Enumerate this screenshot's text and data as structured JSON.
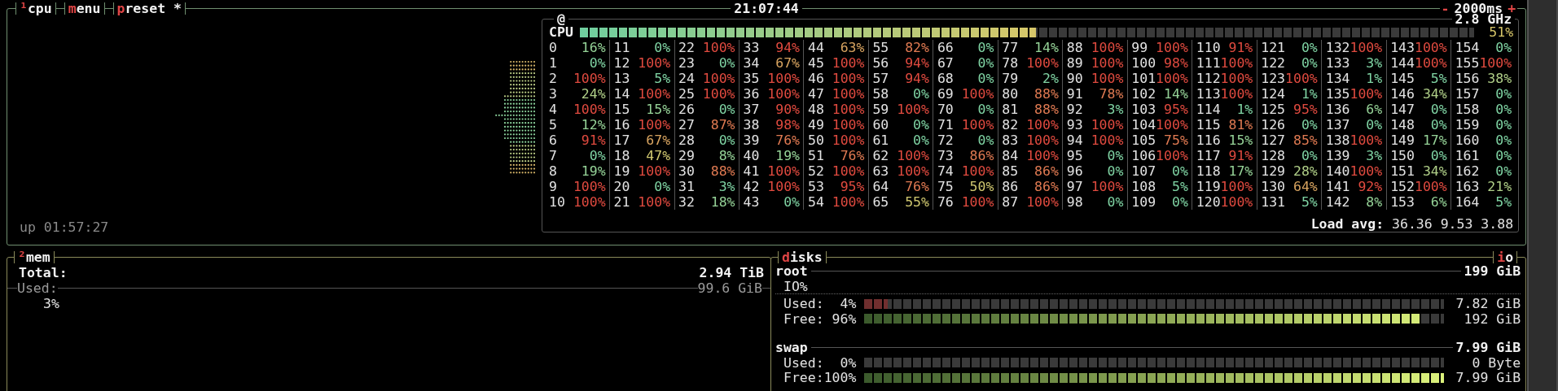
{
  "top_bar": {
    "tabs": [
      {
        "hotkey": "¹",
        "label": "cpu"
      },
      {
        "hotkey": "m",
        "label": "enu"
      },
      {
        "hotkey": "p",
        "label": "reset *"
      }
    ],
    "clock": "21:07:44",
    "interval": {
      "decrease": "-",
      "value": "2000ms",
      "increase": "+"
    }
  },
  "cpu": {
    "graph_title": "@",
    "frequency": "2.8 GHz",
    "total": {
      "label": "CPU",
      "level": 0.51,
      "reading": "51%"
    },
    "uptime": "up 01:57:27",
    "load_avg": {
      "label": "Load avg:",
      "values": "36.36 9.53 3.88"
    },
    "cores": [
      {
        "id": "0",
        "color": "#95d297",
        "reading": "16%"
      },
      {
        "id": "1",
        "color": "#7fd3a3",
        "reading": "0%"
      },
      {
        "id": "2",
        "color": "#e04a3f",
        "reading": "100%"
      },
      {
        "id": "3",
        "color": "#b0cf88",
        "reading": "24%"
      },
      {
        "id": "4",
        "color": "#e04a3f",
        "reading": "100%"
      },
      {
        "id": "5",
        "color": "#95d297",
        "reading": "12%"
      },
      {
        "id": "6",
        "color": "#e04a3f",
        "reading": "91%"
      },
      {
        "id": "7",
        "color": "#7fd3a3",
        "reading": "0%"
      },
      {
        "id": "8",
        "color": "#95d297",
        "reading": "19%"
      },
      {
        "id": "9",
        "color": "#e04a3f",
        "reading": "100%"
      },
      {
        "id": "10",
        "color": "#e04a3f",
        "reading": "100%"
      },
      {
        "id": "11",
        "color": "#7fd3a3",
        "reading": "0%"
      },
      {
        "id": "12",
        "color": "#e04a3f",
        "reading": "100%"
      },
      {
        "id": "13",
        "color": "#7fd3a3",
        "reading": "5%"
      },
      {
        "id": "14",
        "color": "#e04a3f",
        "reading": "100%"
      },
      {
        "id": "15",
        "color": "#95d297",
        "reading": "15%"
      },
      {
        "id": "16",
        "color": "#e04a3f",
        "reading": "100%"
      },
      {
        "id": "17",
        "color": "#d8a460",
        "reading": "67%"
      },
      {
        "id": "18",
        "color": "#d0c870",
        "reading": "47%"
      },
      {
        "id": "19",
        "color": "#e04a3f",
        "reading": "100%"
      },
      {
        "id": "20",
        "color": "#7fd3a3",
        "reading": "0%"
      },
      {
        "id": "21",
        "color": "#e04a3f",
        "reading": "100%"
      },
      {
        "id": "22",
        "color": "#e04a3f",
        "reading": "100%"
      },
      {
        "id": "23",
        "color": "#7fd3a3",
        "reading": "0%"
      },
      {
        "id": "24",
        "color": "#e04a3f",
        "reading": "100%"
      },
      {
        "id": "25",
        "color": "#e04a3f",
        "reading": "100%"
      },
      {
        "id": "26",
        "color": "#7fd3a3",
        "reading": "0%"
      },
      {
        "id": "27",
        "color": "#e07a52",
        "reading": "87%"
      },
      {
        "id": "28",
        "color": "#7fd3a3",
        "reading": "0%"
      },
      {
        "id": "29",
        "color": "#95d297",
        "reading": "8%"
      },
      {
        "id": "30",
        "color": "#e07a52",
        "reading": "88%"
      },
      {
        "id": "31",
        "color": "#7fd3a3",
        "reading": "3%"
      },
      {
        "id": "32",
        "color": "#95d297",
        "reading": "18%"
      },
      {
        "id": "33",
        "color": "#e04a3f",
        "reading": "94%"
      },
      {
        "id": "34",
        "color": "#d8a460",
        "reading": "67%"
      },
      {
        "id": "35",
        "color": "#e04a3f",
        "reading": "100%"
      },
      {
        "id": "36",
        "color": "#e04a3f",
        "reading": "100%"
      },
      {
        "id": "37",
        "color": "#e04a3f",
        "reading": "90%"
      },
      {
        "id": "38",
        "color": "#e04a3f",
        "reading": "98%"
      },
      {
        "id": "39",
        "color": "#e07a52",
        "reading": "76%"
      },
      {
        "id": "40",
        "color": "#95d297",
        "reading": "19%"
      },
      {
        "id": "41",
        "color": "#e04a3f",
        "reading": "100%"
      },
      {
        "id": "42",
        "color": "#e04a3f",
        "reading": "100%"
      },
      {
        "id": "43",
        "color": "#7fd3a3",
        "reading": "0%"
      },
      {
        "id": "44",
        "color": "#d8a460",
        "reading": "63%"
      },
      {
        "id": "45",
        "color": "#e04a3f",
        "reading": "100%"
      },
      {
        "id": "46",
        "color": "#e04a3f",
        "reading": "100%"
      },
      {
        "id": "47",
        "color": "#e04a3f",
        "reading": "100%"
      },
      {
        "id": "48",
        "color": "#e04a3f",
        "reading": "100%"
      },
      {
        "id": "49",
        "color": "#e04a3f",
        "reading": "100%"
      },
      {
        "id": "50",
        "color": "#e04a3f",
        "reading": "100%"
      },
      {
        "id": "51",
        "color": "#e07a52",
        "reading": "76%"
      },
      {
        "id": "52",
        "color": "#e04a3f",
        "reading": "100%"
      },
      {
        "id": "53",
        "color": "#e04a3f",
        "reading": "95%"
      },
      {
        "id": "54",
        "color": "#e04a3f",
        "reading": "100%"
      },
      {
        "id": "55",
        "color": "#e07a52",
        "reading": "82%"
      },
      {
        "id": "56",
        "color": "#e04a3f",
        "reading": "94%"
      },
      {
        "id": "57",
        "color": "#e04a3f",
        "reading": "94%"
      },
      {
        "id": "58",
        "color": "#7fd3a3",
        "reading": "0%"
      },
      {
        "id": "59",
        "color": "#e04a3f",
        "reading": "100%"
      },
      {
        "id": "60",
        "color": "#7fd3a3",
        "reading": "0%"
      },
      {
        "id": "61",
        "color": "#7fd3a3",
        "reading": "0%"
      },
      {
        "id": "62",
        "color": "#e04a3f",
        "reading": "100%"
      },
      {
        "id": "63",
        "color": "#e04a3f",
        "reading": "100%"
      },
      {
        "id": "64",
        "color": "#e07a52",
        "reading": "76%"
      },
      {
        "id": "65",
        "color": "#d0c870",
        "reading": "55%"
      },
      {
        "id": "66",
        "color": "#7fd3a3",
        "reading": "0%"
      },
      {
        "id": "67",
        "color": "#7fd3a3",
        "reading": "0%"
      },
      {
        "id": "68",
        "color": "#7fd3a3",
        "reading": "0%"
      },
      {
        "id": "69",
        "color": "#e04a3f",
        "reading": "100%"
      },
      {
        "id": "70",
        "color": "#7fd3a3",
        "reading": "0%"
      },
      {
        "id": "71",
        "color": "#e04a3f",
        "reading": "100%"
      },
      {
        "id": "72",
        "color": "#7fd3a3",
        "reading": "0%"
      },
      {
        "id": "73",
        "color": "#e07a52",
        "reading": "86%"
      },
      {
        "id": "74",
        "color": "#e04a3f",
        "reading": "100%"
      },
      {
        "id": "75",
        "color": "#d0c870",
        "reading": "50%"
      },
      {
        "id": "76",
        "color": "#e04a3f",
        "reading": "100%"
      },
      {
        "id": "77",
        "color": "#95d297",
        "reading": "14%"
      },
      {
        "id": "78",
        "color": "#e04a3f",
        "reading": "100%"
      },
      {
        "id": "79",
        "color": "#7fd3a3",
        "reading": "2%"
      },
      {
        "id": "80",
        "color": "#e07a52",
        "reading": "88%"
      },
      {
        "id": "81",
        "color": "#e07a52",
        "reading": "88%"
      },
      {
        "id": "82",
        "color": "#e04a3f",
        "reading": "100%"
      },
      {
        "id": "83",
        "color": "#e04a3f",
        "reading": "100%"
      },
      {
        "id": "84",
        "color": "#e04a3f",
        "reading": "100%"
      },
      {
        "id": "85",
        "color": "#e07a52",
        "reading": "86%"
      },
      {
        "id": "86",
        "color": "#e07a52",
        "reading": "86%"
      },
      {
        "id": "87",
        "color": "#e04a3f",
        "reading": "100%"
      },
      {
        "id": "88",
        "color": "#e04a3f",
        "reading": "100%"
      },
      {
        "id": "89",
        "color": "#e04a3f",
        "reading": "100%"
      },
      {
        "id": "90",
        "color": "#e04a3f",
        "reading": "100%"
      },
      {
        "id": "91",
        "color": "#e07a52",
        "reading": "78%"
      },
      {
        "id": "92",
        "color": "#7fd3a3",
        "reading": "3%"
      },
      {
        "id": "93",
        "color": "#e04a3f",
        "reading": "100%"
      },
      {
        "id": "94",
        "color": "#e04a3f",
        "reading": "100%"
      },
      {
        "id": "95",
        "color": "#7fd3a3",
        "reading": "0%"
      },
      {
        "id": "96",
        "color": "#7fd3a3",
        "reading": "0%"
      },
      {
        "id": "97",
        "color": "#e04a3f",
        "reading": "100%"
      },
      {
        "id": "98",
        "color": "#7fd3a3",
        "reading": "0%"
      },
      {
        "id": "99",
        "color": "#e04a3f",
        "reading": "100%"
      },
      {
        "id": "100",
        "color": "#e04a3f",
        "reading": "98%"
      },
      {
        "id": "101",
        "color": "#e04a3f",
        "reading": "100%"
      },
      {
        "id": "102",
        "color": "#95d297",
        "reading": "14%"
      },
      {
        "id": "103",
        "color": "#e04a3f",
        "reading": "95%"
      },
      {
        "id": "104",
        "color": "#e04a3f",
        "reading": "100%"
      },
      {
        "id": "105",
        "color": "#e07a52",
        "reading": "75%"
      },
      {
        "id": "106",
        "color": "#e04a3f",
        "reading": "100%"
      },
      {
        "id": "107",
        "color": "#7fd3a3",
        "reading": "0%"
      },
      {
        "id": "108",
        "color": "#7fd3a3",
        "reading": "5%"
      },
      {
        "id": "109",
        "color": "#7fd3a3",
        "reading": "0%"
      },
      {
        "id": "110",
        "color": "#e04a3f",
        "reading": "91%"
      },
      {
        "id": "111",
        "color": "#e04a3f",
        "reading": "100%"
      },
      {
        "id": "112",
        "color": "#e04a3f",
        "reading": "100%"
      },
      {
        "id": "113",
        "color": "#e04a3f",
        "reading": "100%"
      },
      {
        "id": "114",
        "color": "#7fd3a3",
        "reading": "1%"
      },
      {
        "id": "115",
        "color": "#e07a52",
        "reading": "81%"
      },
      {
        "id": "116",
        "color": "#95d297",
        "reading": "15%"
      },
      {
        "id": "117",
        "color": "#e04a3f",
        "reading": "91%"
      },
      {
        "id": "118",
        "color": "#95d297",
        "reading": "17%"
      },
      {
        "id": "119",
        "color": "#e04a3f",
        "reading": "100%"
      },
      {
        "id": "120",
        "color": "#e04a3f",
        "reading": "100%"
      },
      {
        "id": "121",
        "color": "#7fd3a3",
        "reading": "0%"
      },
      {
        "id": "122",
        "color": "#7fd3a3",
        "reading": "0%"
      },
      {
        "id": "123",
        "color": "#e04a3f",
        "reading": "100%"
      },
      {
        "id": "124",
        "color": "#7fd3a3",
        "reading": "1%"
      },
      {
        "id": "125",
        "color": "#e04a3f",
        "reading": "95%"
      },
      {
        "id": "126",
        "color": "#7fd3a3",
        "reading": "0%"
      },
      {
        "id": "127",
        "color": "#e07a52",
        "reading": "85%"
      },
      {
        "id": "128",
        "color": "#7fd3a3",
        "reading": "0%"
      },
      {
        "id": "129",
        "color": "#b0cf88",
        "reading": "28%"
      },
      {
        "id": "130",
        "color": "#d8a460",
        "reading": "64%"
      },
      {
        "id": "131",
        "color": "#7fd3a3",
        "reading": "5%"
      },
      {
        "id": "132",
        "color": "#e04a3f",
        "reading": "100%"
      },
      {
        "id": "133",
        "color": "#7fd3a3",
        "reading": "3%"
      },
      {
        "id": "134",
        "color": "#7fd3a3",
        "reading": "1%"
      },
      {
        "id": "135",
        "color": "#e04a3f",
        "reading": "100%"
      },
      {
        "id": "136",
        "color": "#95d297",
        "reading": "6%"
      },
      {
        "id": "137",
        "color": "#7fd3a3",
        "reading": "0%"
      },
      {
        "id": "138",
        "color": "#e04a3f",
        "reading": "100%"
      },
      {
        "id": "139",
        "color": "#7fd3a3",
        "reading": "3%"
      },
      {
        "id": "140",
        "color": "#e04a3f",
        "reading": "100%"
      },
      {
        "id": "141",
        "color": "#e04a3f",
        "reading": "92%"
      },
      {
        "id": "142",
        "color": "#95d297",
        "reading": "8%"
      },
      {
        "id": "143",
        "color": "#e04a3f",
        "reading": "100%"
      },
      {
        "id": "144",
        "color": "#e04a3f",
        "reading": "100%"
      },
      {
        "id": "145",
        "color": "#7fd3a3",
        "reading": "5%"
      },
      {
        "id": "146",
        "color": "#b0cf88",
        "reading": "34%"
      },
      {
        "id": "147",
        "color": "#7fd3a3",
        "reading": "0%"
      },
      {
        "id": "148",
        "color": "#7fd3a3",
        "reading": "0%"
      },
      {
        "id": "149",
        "color": "#95d297",
        "reading": "17%"
      },
      {
        "id": "150",
        "color": "#7fd3a3",
        "reading": "0%"
      },
      {
        "id": "151",
        "color": "#b0cf88",
        "reading": "34%"
      },
      {
        "id": "152",
        "color": "#e04a3f",
        "reading": "100%"
      },
      {
        "id": "153",
        "color": "#95d297",
        "reading": "6%"
      },
      {
        "id": "154",
        "color": "#7fd3a3",
        "reading": "0%"
      },
      {
        "id": "155",
        "color": "#e04a3f",
        "reading": "100%"
      },
      {
        "id": "156",
        "color": "#b0cf88",
        "reading": "38%"
      },
      {
        "id": "157",
        "color": "#7fd3a3",
        "reading": "0%"
      },
      {
        "id": "158",
        "color": "#7fd3a3",
        "reading": "0%"
      },
      {
        "id": "159",
        "color": "#7fd3a3",
        "reading": "0%"
      },
      {
        "id": "160",
        "color": "#7fd3a3",
        "reading": "0%"
      },
      {
        "id": "161",
        "color": "#7fd3a3",
        "reading": "0%"
      },
      {
        "id": "162",
        "color": "#7fd3a3",
        "reading": "0%"
      },
      {
        "id": "163",
        "color": "#b0cf88",
        "reading": "21%"
      },
      {
        "id": "164",
        "color": "#7fd3a3",
        "reading": "5%"
      }
    ]
  },
  "mem": {
    "title": {
      "hotkey": "²",
      "label": "mem"
    },
    "total": {
      "label": "Total:",
      "value": "2.94 TiB"
    },
    "used": {
      "label": "Used:",
      "value": "99.6 GiB",
      "percent": "3%"
    }
  },
  "disks": {
    "title": {
      "hotkey": "d",
      "label": "isks"
    },
    "io_button": {
      "hotkey": "i",
      "label": "o"
    },
    "volumes": [
      {
        "name": "root",
        "size": "199 GiB",
        "io": "IO%",
        "meters": [
          {
            "kind": "used",
            "label": "Used:",
            "percent": "4%",
            "level": 0.04,
            "value": "7.82 GiB"
          },
          {
            "kind": "free",
            "label": "Free:",
            "percent": "96%",
            "level": 0.96,
            "value": "192 GiB"
          }
        ]
      },
      {
        "name": "swap",
        "size": "7.99 GiB",
        "meters": [
          {
            "kind": "used",
            "label": "Used:",
            "percent": "0%",
            "level": 0,
            "value": "0 Byte"
          },
          {
            "kind": "free",
            "label": "Free:",
            "percent": "100%",
            "level": 1,
            "value": "7.99 GiB"
          }
        ]
      }
    ]
  }
}
